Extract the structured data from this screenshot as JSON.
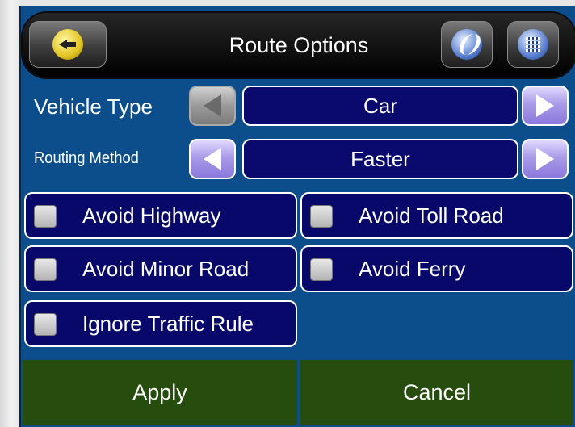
{
  "header": {
    "title": "Route Options",
    "back_icon": "back-arrow-icon",
    "logo_icon": "app-logo-icon",
    "menu_icon": "menu-grid-icon"
  },
  "vehicle": {
    "label": "Vehicle Type",
    "value": "Car",
    "prev_enabled": false,
    "next_enabled": true
  },
  "routing": {
    "label": "Routing Method",
    "value": "Faster",
    "prev_enabled": true,
    "next_enabled": true
  },
  "options": [
    {
      "label": "Avoid Highway",
      "checked": false
    },
    {
      "label": "Avoid Toll Road",
      "checked": false
    },
    {
      "label": "Avoid Minor Road",
      "checked": false
    },
    {
      "label": "Avoid Ferry",
      "checked": false
    },
    {
      "label": "Ignore Traffic Rule",
      "checked": false
    }
  ],
  "actions": {
    "apply_label": "Apply",
    "cancel_label": "Cancel"
  },
  "colors": {
    "background": "#0c4d8c",
    "field": "#08086a",
    "arrow_active": "#a99be8",
    "action_button": "#264d0e"
  }
}
